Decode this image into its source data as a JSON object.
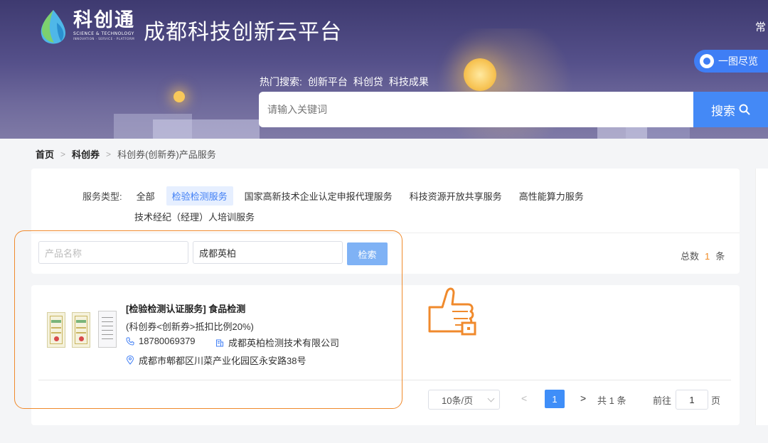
{
  "header": {
    "logo_text": "科创通",
    "logo_subtitle": "SCIENCE & TECHNOLOGY",
    "logo_subtitle2": "INNOVATION · SERVICE · PLATFORM",
    "site_title": "成都科技创新云平台",
    "corner_text": "常",
    "overview_button": "一图尽览",
    "hot_search_label": "热门搜索:",
    "hot_search_items": [
      "创新平台",
      "科创贷",
      "科技成果"
    ],
    "search_placeholder": "请输入关键词",
    "search_button": "搜索"
  },
  "breadcrumb": [
    "首页",
    "科创券",
    "科创券(创新券)产品服务"
  ],
  "filter": {
    "label": "服务类型:",
    "tags": [
      "全部",
      "检验检测服务",
      "国家高新技术企业认定申报代理服务",
      "科技资源开放共享服务",
      "高性能算力服务"
    ],
    "tags_row2": [
      "技术经纪（经理）人培训服务"
    ],
    "active_tag": "检验检测服务"
  },
  "search_form": {
    "product_name_placeholder": "产品名称",
    "company_value": "成都英柏",
    "search_button": "检索",
    "total_label": "总数",
    "total_count": "1",
    "total_unit": "条"
  },
  "results": [
    {
      "title": "[检验检测认证服务] 食品检测",
      "subtitle": "(科创券<创新券>抵扣比例20%)",
      "phone": "18780069379",
      "company": "成都英柏检测技术有限公司",
      "address": "成都市郫都区川菜产业化园区永安路38号"
    }
  ],
  "pagination": {
    "page_size": "10条/页",
    "prev": "<",
    "current_page": "1",
    "next": ">",
    "total_text": "共 1 条",
    "goto_label": "前往",
    "goto_value": "1",
    "goto_unit": "页"
  },
  "colors": {
    "accent": "#3f7ef5",
    "highlight": "#f08a2c",
    "count": "#f08a24"
  }
}
